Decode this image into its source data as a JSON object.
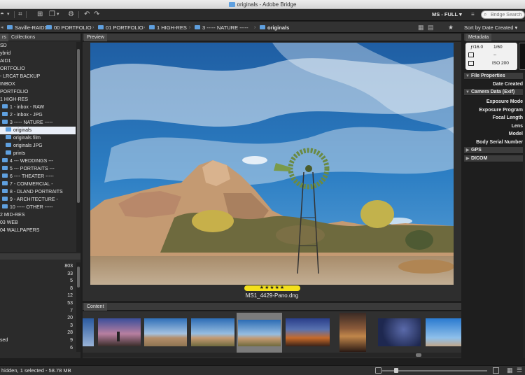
{
  "window": {
    "title": "originals - Adobe Bridge"
  },
  "toolbar": {
    "workspace_label": "MS - FULL",
    "workspace_arrow": "▾",
    "search_placeholder": "Bridge Search"
  },
  "breadcrumb": [
    {
      "label": "Saville-RAID1"
    },
    {
      "label": "00 PORTFOLIO"
    },
    {
      "label": "01 PORTFOLIO"
    },
    {
      "label": "1 HIGH-RES"
    },
    {
      "label": "3 ----- NATURE -----"
    },
    {
      "label": "originals"
    }
  ],
  "sort": {
    "label": "Sort by Date Created"
  },
  "left_panel": {
    "tabs": [
      {
        "label": "rs"
      },
      {
        "label": "Collections"
      }
    ],
    "folders": [
      {
        "label": "SD",
        "indent": 0,
        "folder": false
      },
      {
        "label": "ybrid",
        "indent": 0,
        "folder": false
      },
      {
        "label": "AID1",
        "indent": 0,
        "folder": false
      },
      {
        "label": "ORTFOLIO",
        "indent": 0,
        "folder": false
      },
      {
        "label": "- LRCAT BACKUP",
        "indent": 0,
        "folder": false
      },
      {
        "label": "INBOX",
        "indent": 0,
        "folder": false
      },
      {
        "label": "PORTFOLIO",
        "indent": 0,
        "folder": false
      },
      {
        "label": "1 HIGH-RES",
        "indent": 0,
        "folder": false
      },
      {
        "label": "1 - inbox - RAW",
        "indent": 1,
        "folder": true
      },
      {
        "label": "2 - inbox - JPG",
        "indent": 1,
        "folder": true
      },
      {
        "label": "3 ----- NATURE -----",
        "indent": 1,
        "folder": true
      },
      {
        "label": "originals",
        "indent": 2,
        "folder": true,
        "selected": true
      },
      {
        "label": "originals film",
        "indent": 2,
        "folder": true
      },
      {
        "label": "originals JPG",
        "indent": 2,
        "folder": true
      },
      {
        "label": "prints",
        "indent": 2,
        "folder": true
      },
      {
        "label": "4 --- WEDDINGS ---",
        "indent": 1,
        "folder": true
      },
      {
        "label": "5 --- PORTRAITS ---",
        "indent": 1,
        "folder": true
      },
      {
        "label": "6 ---- THEATER -----",
        "indent": 1,
        "folder": true
      },
      {
        "label": "7 - COMMERCIAL -",
        "indent": 1,
        "folder": true
      },
      {
        "label": "8 - DLAND PORTRAITS",
        "indent": 1,
        "folder": true
      },
      {
        "label": "9 - ARCHITECTURE -",
        "indent": 1,
        "folder": true
      },
      {
        "label": "10 ----- OTHER -----",
        "indent": 1,
        "folder": true
      },
      {
        "label": "2 MID-RES",
        "indent": 0,
        "folder": false
      },
      {
        "label": "03 WEB",
        "indent": 0,
        "folder": false
      },
      {
        "label": "04 WALLPAPERS",
        "indent": 0,
        "folder": false
      }
    ],
    "counts": [
      {
        "label": "",
        "value": "803"
      },
      {
        "label": "",
        "value": "33"
      },
      {
        "label": "",
        "value": "5"
      },
      {
        "label": "",
        "value": "8"
      },
      {
        "label": "",
        "value": "12"
      },
      {
        "label": "",
        "value": "53"
      },
      {
        "label": "",
        "value": "7"
      },
      {
        "label": "",
        "value": "20"
      },
      {
        "label": "",
        "value": "3"
      },
      {
        "label": "",
        "value": "28"
      },
      {
        "label": "sed",
        "value": "9"
      },
      {
        "label": "",
        "value": "6"
      }
    ]
  },
  "preview": {
    "header": "Preview",
    "rating": "★★★★★",
    "rating_value": 5,
    "filename": "MS1_4429-Pano.dng"
  },
  "content": {
    "header": "Content",
    "thumbnails": [
      {
        "kind": "partial-sky"
      },
      {
        "kind": "dusk-figure"
      },
      {
        "kind": "desert-rocks"
      },
      {
        "kind": "windmill-rocks"
      },
      {
        "kind": "windmill-rocks",
        "selected": true
      },
      {
        "kind": "night-cabin"
      },
      {
        "kind": "night-cabin-vertical"
      },
      {
        "kind": "milky-way"
      },
      {
        "kind": "blue-sky-partial"
      }
    ]
  },
  "metadata": {
    "header": "Metadata",
    "camera": {
      "aperture": "ƒ/16.0",
      "shutter": "1/60",
      "dash": "--",
      "iso": "ISO 200"
    },
    "sections": [
      {
        "label": "File Properties",
        "expanded": true,
        "fields": [
          "Date Created"
        ]
      },
      {
        "label": "Camera Data (Exif)",
        "expanded": true,
        "fields": [
          "Exposure Mode",
          "Exposure Program",
          "Focal Length",
          "Lens",
          "Model",
          "Body Serial Number"
        ]
      },
      {
        "label": "GPS",
        "expanded": false,
        "fields": []
      },
      {
        "label": "DICOM",
        "expanded": false,
        "fields": []
      }
    ]
  },
  "status": {
    "text": "hidden, 1 selected - 58.78 MB"
  },
  "colors": {
    "folder_blue": "#5fa0df",
    "rating_yellow": "#f3e01c",
    "panel_bg": "#2b2b2b",
    "selection_bg": "#e9eef7"
  }
}
